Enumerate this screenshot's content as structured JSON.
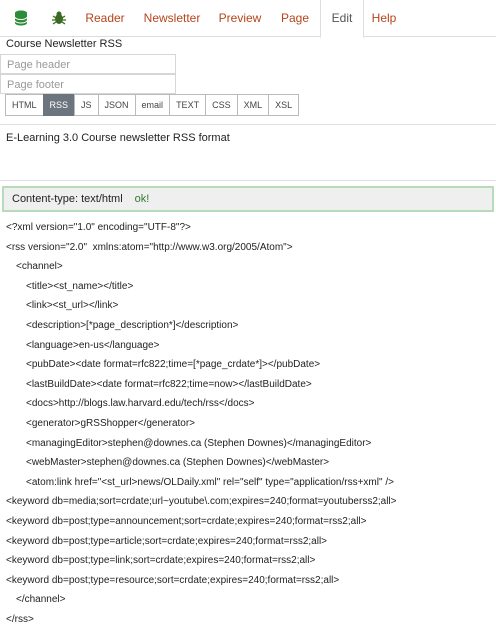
{
  "toolbar": {
    "tabs": [
      {
        "label": "Reader"
      },
      {
        "label": "Newsletter"
      },
      {
        "label": "Preview"
      },
      {
        "label": "Page"
      },
      {
        "label": "Edit"
      },
      {
        "label": "Help"
      }
    ],
    "active_tab": "Edit",
    "accent": "#b5451b"
  },
  "page": {
    "title": "Course Newsletter RSS",
    "header_placeholder": "Page header",
    "footer_placeholder": "Page footer",
    "formats": [
      "HTML",
      "RSS",
      "JS",
      "JSON",
      "email",
      "TEXT",
      "CSS",
      "XML",
      "XSL"
    ],
    "active_format": "RSS",
    "description": "E-Learning 3.0 Course newsletter RSS format"
  },
  "content_type": {
    "label": "Content-type: text/html",
    "status": "ok!"
  },
  "code_lines": [
    "<?xml version=\"1.0\" encoding=\"UTF-8\"?>",
    "<rss version=\"2.0\"  xmlns:atom=\"http://www.w3.org/2005/Atom\">",
    "<channel>",
    "<title><st_name></title>",
    "<link><st_url></link>",
    "<description>[*page_description*]</description>",
    "<language>en-us</language>",
    "<pubDate><date format=rfc822;time=[*page_crdate*]></pubDate>",
    "<lastBuildDate><date format=rfc822;time=now></lastBuildDate>",
    "<docs>http://blogs.law.harvard.edu/tech/rss</docs>",
    "<generator>gRSShopper</generator>",
    "<managingEditor>stephen@downes.ca (Stephen Downes)</managingEditor>",
    "<webMaster>stephen@downes.ca (Stephen Downes)</webMaster>",
    "<atom:link href=\"<st_url>news/OLDaily.xml\" rel=\"self\" type=\"application/rss+xml\" />",
    "<keyword db=media;sort=crdate;url~youtube\\.com;expires=240;format=youtuberss2;all>",
    "<keyword db=post;type=announcement;sort=crdate;expires=240;format=rss2;all>",
    "<keyword db=post;type=article;sort=crdate;expires=240;format=rss2;all>",
    "<keyword db=post;type=link;sort=crdate;expires=240;format=rss2;all>",
    "<keyword db=post;type=resource;sort=crdate;expires=240;format=rss2;all>",
    "</channel>",
    "</rss>"
  ]
}
